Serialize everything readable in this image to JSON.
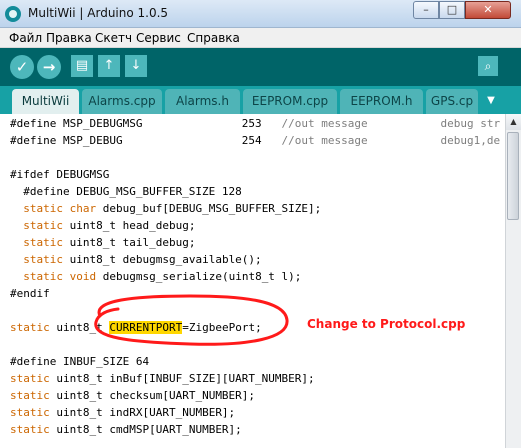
{
  "window": {
    "title": "MultiWii | Arduino 1.0.5",
    "minimize_glyph": "–",
    "maximize_glyph": "□",
    "close_glyph": "✕"
  },
  "menu": {
    "items": [
      "Файл",
      "Правка",
      "Скетч",
      "Сервис",
      "Справка"
    ]
  },
  "toolbar": {
    "buttons": [
      "verify-icon",
      "upload-icon",
      "new-icon",
      "open-icon",
      "save-icon",
      "serial-monitor-icon"
    ],
    "glyphs": {
      "verify": "✓",
      "upload": "→",
      "new": "▤",
      "open": "↑",
      "save": "↓",
      "monitor": "⌕"
    }
  },
  "tabs": {
    "items": [
      "MultiWii",
      "Alarms.cpp",
      "Alarms.h",
      "EEPROM.cpp",
      "EEPROM.h",
      "GPS.cp"
    ],
    "active_index": 0,
    "menu_glyph": "▼"
  },
  "code": {
    "lines": [
      "#define MSP_DEBUGMSG               253   //out message           debug str",
      "#define MSP_DEBUG                  254   //out message           debug1,de",
      "",
      "#ifdef DEBUGMSG",
      "  #define DEBUG_MSG_BUFFER_SIZE 128",
      "  static char debug_buf[DEBUG_MSG_BUFFER_SIZE];",
      "  static uint8_t head_debug;",
      "  static uint8_t tail_debug;",
      "  static uint8_t debugmsg_available();",
      "  static void debugmsg_serialize(uint8_t l);",
      "#endif",
      "",
      "static uint8_t CURRENTPORT=ZigbeePort;",
      "",
      "#define INBUF_SIZE 64",
      "static uint8_t inBuf[INBUF_SIZE][UART_NUMBER];",
      "static uint8_t checksum[UART_NUMBER];",
      "static uint8_t indRX[UART_NUMBER];",
      "static uint8_t cmdMSP[UART_NUMBER];"
    ],
    "highlighted_word": "CURRENTPORT"
  },
  "annotation": {
    "text": "Change to Protocol.cpp",
    "color": "#ff1a1a"
  },
  "colors": {
    "toolbar": "#006468",
    "tabbar": "#17a1a5",
    "keyword": "#cc6600",
    "comment": "#7e7e7e",
    "highlight": "#ffd700"
  }
}
